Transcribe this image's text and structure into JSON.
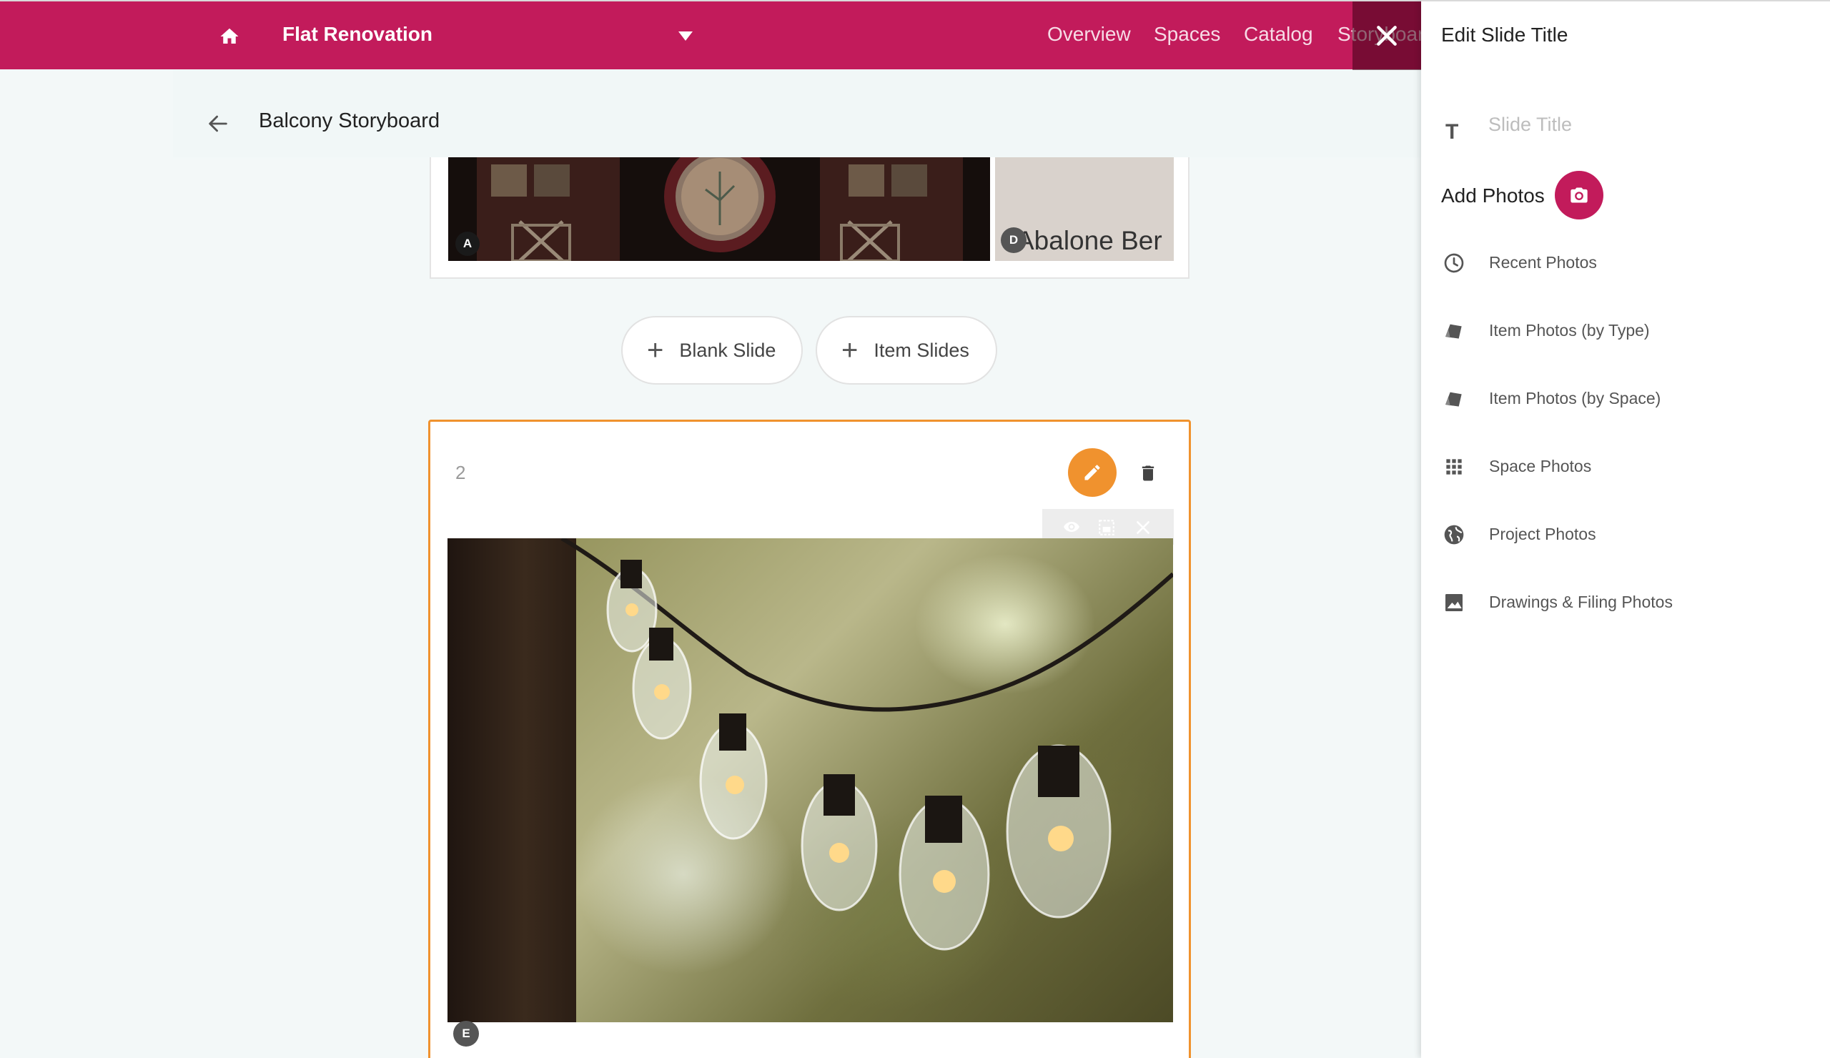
{
  "topbar": {
    "project_title": "Flat Renovation",
    "nav": [
      "Overview",
      "Spaces",
      "Catalog",
      "Storyboard"
    ],
    "accent_color": "#c21b5b"
  },
  "subheader": {
    "title": "Balcony Storyboard"
  },
  "slide1": {
    "badges": [
      "A",
      "D"
    ],
    "photo_d_text": "Abalone Ber"
  },
  "add_buttons": {
    "blank": "Blank Slide",
    "item": "Item Slides"
  },
  "slide2": {
    "number": "2",
    "badge": "E",
    "accent_color": "#f0922e"
  },
  "drawer": {
    "title": "Edit Slide Title",
    "title_placeholder": "Slide Title",
    "add_photos_label": "Add Photos",
    "menu": [
      {
        "label": "Recent Photos",
        "icon": "clock-icon"
      },
      {
        "label": "Item Photos (by Type)",
        "icon": "tag-icon"
      },
      {
        "label": "Item Photos (by Space)",
        "icon": "tag-icon"
      },
      {
        "label": "Space Photos",
        "icon": "grid-icon"
      },
      {
        "label": "Project Photos",
        "icon": "globe-icon"
      },
      {
        "label": "Drawings & Filing Photos",
        "icon": "image-icon"
      }
    ]
  }
}
